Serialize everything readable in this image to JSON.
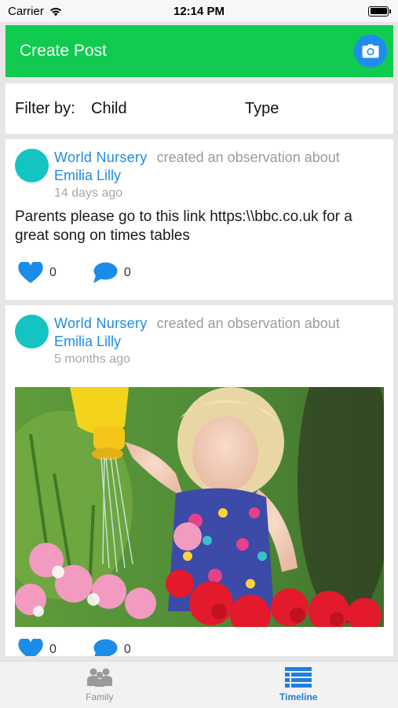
{
  "status_bar": {
    "carrier": "Carrier",
    "time": "12:14 PM"
  },
  "header": {
    "title": "Create Post",
    "camera_icon": "camera-icon"
  },
  "filter": {
    "label": "Filter by:",
    "child": "Child",
    "type": "Type"
  },
  "posts": [
    {
      "author": "World  Nursery",
      "action": "created an observation about",
      "child": "Emilia Lilly",
      "time_ago": "14 days ago",
      "text": "Parents please go to this link https:\\\\bbc.co.uk for a great song on times tables",
      "likes": "0",
      "comments": "0"
    },
    {
      "author": "World  Nursery",
      "action": "created an observation about",
      "child": "Emilia Lilly",
      "time_ago": "5 months ago",
      "image": "photo-girl-watering-flowers",
      "likes": "0",
      "comments": "0"
    }
  ],
  "tabs": [
    {
      "label": "Family",
      "icon": "family-icon",
      "active": false
    },
    {
      "label": "Timeline",
      "icon": "timeline-icon",
      "active": true
    }
  ],
  "colors": {
    "header_green": "#10cb4f",
    "accent_blue": "#1b8ce8",
    "avatar_teal": "#14c4c2"
  }
}
